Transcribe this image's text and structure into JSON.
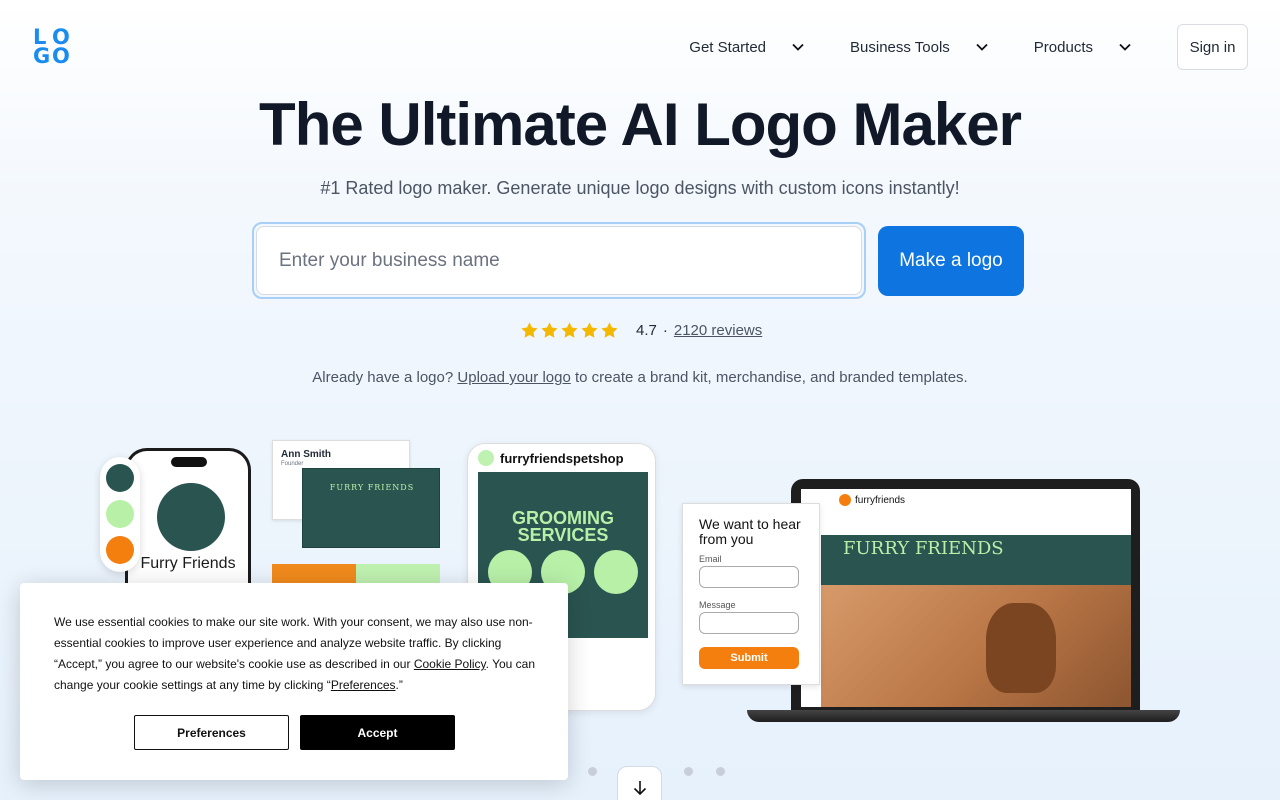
{
  "brand": {
    "logo_letters": [
      "L",
      "O",
      "G",
      "O"
    ],
    "accent": "#0d74e0"
  },
  "nav": {
    "items": [
      {
        "label": "Get Started",
        "icon": "chevron-down-icon"
      },
      {
        "label": "Business Tools",
        "icon": "chevron-down-icon"
      },
      {
        "label": "Products",
        "icon": "chevron-down-icon"
      }
    ],
    "signin_label": "Sign in"
  },
  "hero": {
    "title": "The Ultimate AI Logo Maker",
    "subtitle": "#1 Rated logo maker. Generate unique logo designs with custom icons instantly!",
    "input_placeholder": "Enter your business name",
    "input_value": "",
    "cta_label": "Make a logo"
  },
  "rating": {
    "stars": 5,
    "star_color": "#f5b800",
    "score": "4.7",
    "separator": "·",
    "reviews_label": "2120 reviews"
  },
  "upload": {
    "prefix": "Already have a logo?",
    "link": "Upload your logo",
    "suffix": "to create a brand kit, merchandise, and branded templates."
  },
  "showcase": {
    "swatches": [
      "#2a5450",
      "#b8f0a8",
      "#f57f0e"
    ],
    "phone_name": "Furry Friends",
    "business_card": {
      "name": "Ann Smith",
      "role": "Founder",
      "back_text": "FURRY FRIENDS"
    },
    "social": {
      "handle": "furryfriendspetshop",
      "headline": "GROOMING SERVICES"
    },
    "form": {
      "heading": "We want to hear from you",
      "email_label": "Email",
      "message_label": "Message",
      "submit_label": "Submit"
    },
    "website": {
      "site_name": "furryfriends",
      "banner": "FURRY FRIENDS"
    }
  },
  "cookie": {
    "text_1": "We use essential cookies to make our site work. With your consent, we may also use non-essential cookies to improve user experience and analyze website traffic. By clicking “Accept,” you agree to our website's cookie use as described in our",
    "policy_link": "Cookie Policy",
    "text_2": ". You can change your cookie settings at any time by clicking “",
    "preferences_link": "Preferences",
    "text_3": ".”",
    "preferences_button": "Preferences",
    "accept_button": "Accept"
  },
  "carousel": {
    "dot_count": 3,
    "scroll_icon": "arrow-down-icon"
  }
}
